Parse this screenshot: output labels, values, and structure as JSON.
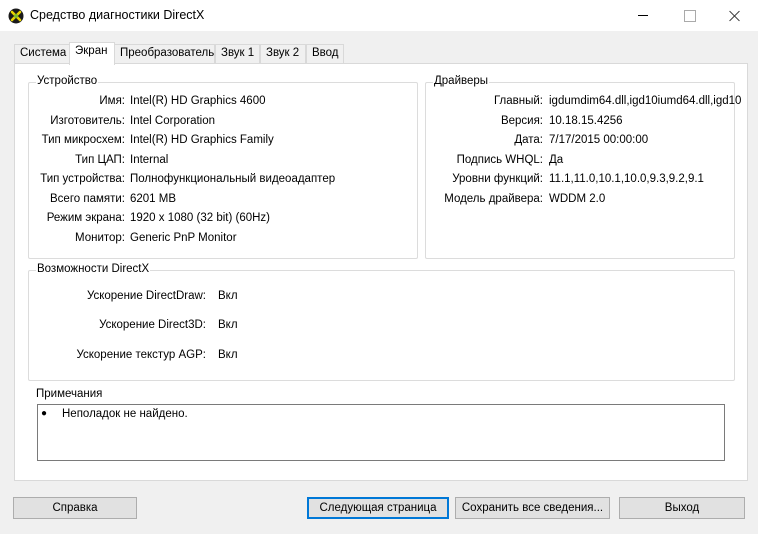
{
  "window": {
    "title": "Средство диагностики DirectX",
    "app_icon": "directx-icon"
  },
  "tabs": [
    {
      "label": "Система",
      "active": false
    },
    {
      "label": "Экран",
      "active": true
    },
    {
      "label": "Преобразователь",
      "active": false
    },
    {
      "label": "Звук 1",
      "active": false
    },
    {
      "label": "Звук 2",
      "active": false
    },
    {
      "label": "Ввод",
      "active": false
    }
  ],
  "device": {
    "title": "Устройство",
    "rows": [
      {
        "label": "Имя:",
        "value": "Intel(R) HD Graphics 4600"
      },
      {
        "label": "Изготовитель:",
        "value": "Intel Corporation"
      },
      {
        "label": "Тип микросхем:",
        "value": "Intel(R) HD Graphics Family"
      },
      {
        "label": "Тип ЦАП:",
        "value": "Internal"
      },
      {
        "label": "Тип устройства:",
        "value": "Полнофункциональный видеоадаптер"
      },
      {
        "label": "Всего памяти:",
        "value": "6201 MB"
      },
      {
        "label": "Режим экрана:",
        "value": "1920 x 1080 (32 bit) (60Hz)"
      },
      {
        "label": "Монитор:",
        "value": "Generic PnP Monitor"
      }
    ]
  },
  "drivers": {
    "title": "Драйверы",
    "rows": [
      {
        "label": "Главный:",
        "value": "igdumdim64.dll,igd10iumd64.dll,igd10"
      },
      {
        "label": "Версия:",
        "value": "10.18.15.4256"
      },
      {
        "label": "Дата:",
        "value": "7/17/2015 00:00:00"
      },
      {
        "label": "Подпись WHQL:",
        "value": "Да"
      },
      {
        "label": "Уровни функций:",
        "value": "11.1,11.0,10.1,10.0,9.3,9.2,9.1"
      },
      {
        "label": "Модель драйвера:",
        "value": "WDDM 2.0"
      }
    ]
  },
  "directx_features": {
    "title": "Возможности DirectX",
    "rows": [
      {
        "label": "Ускорение DirectDraw:",
        "value": "Вкл"
      },
      {
        "label": "Ускорение Direct3D:",
        "value": "Вкл"
      },
      {
        "label": "Ускорение текстур AGP:",
        "value": "Вкл"
      }
    ]
  },
  "notes": {
    "title": "Примечания",
    "items": [
      "Неполадок не найдено."
    ]
  },
  "buttons": {
    "help": "Справка",
    "next_page": "Следующая страница",
    "save_all": "Сохранить все сведения...",
    "exit": "Выход"
  }
}
